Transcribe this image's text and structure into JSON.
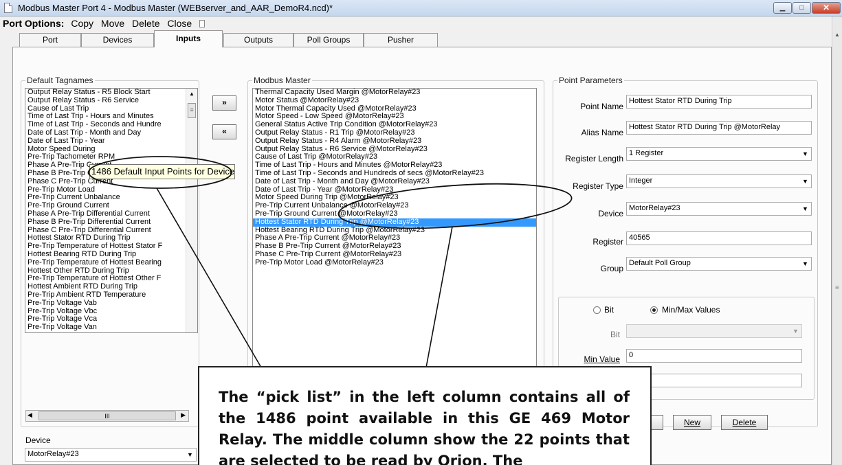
{
  "window": {
    "title": "Modbus Master Port 4 - Modbus Master (WEBserver_and_AAR_DemoR4.ncd)*"
  },
  "port_options": {
    "label": "Port Options:",
    "items": [
      "Copy",
      "Move",
      "Delete",
      "Close"
    ]
  },
  "tabs": [
    {
      "label": "Port"
    },
    {
      "label": "Devices"
    },
    {
      "label": "Inputs"
    },
    {
      "label": "Outputs"
    },
    {
      "label": "Poll Groups"
    },
    {
      "label": "Pusher"
    }
  ],
  "default_tagnames": {
    "legend": "Default Tagnames",
    "items": [
      "Output Relay Status - R5 Block Start",
      "Output Relay Status - R6 Service",
      "Cause of Last Trip",
      "Time of Last Trip - Hours and Minutes",
      "Time of Last Trip - Seconds and Hundre",
      "Date of Last Trip - Month and Day",
      "Date of Last Trip - Year",
      "Motor Speed During",
      "Pre-Trip Tachometer RPM",
      "Phase A Pre-Trip Current",
      "Phase B Pre-Trip Current",
      "Phase C Pre-Trip Current",
      "Pre-Trip Motor Load",
      "Pre-Trip Current Unbalance",
      "Pre-Trip Ground Current",
      "Phase A Pre-Trip Differential Current",
      "Phase B Pre-Trip Differential Current",
      "Phase C Pre-Trip Differential Current",
      "Hottest Stator RTD During Trip",
      "Pre-Trip Temperature of Hottest Stator F",
      "Hottest Bearing RTD During Trip",
      "Pre-Trip Temperature of Hottest Bearing",
      "Hottest Other RTD During Trip",
      "Pre-Trip Temperature of Hottest Other F",
      "Hottest Ambient RTD During Trip",
      "Pre-Trip Ambient RTD Temperature",
      "Pre-Trip Voltage Vab",
      "Pre-Trip Voltage Vbc",
      "Pre-Trip Voltage Vca",
      "Pre-Trip Voltage Van"
    ],
    "hscroll_grip": "III"
  },
  "tooltip": "1486 Default Input Points for Device",
  "move_buttons": {
    "add": "»",
    "remove": "«"
  },
  "device": {
    "label": "Device",
    "value": "MotorRelay#23"
  },
  "modbus_master": {
    "legend": "Modbus Master",
    "items": [
      "Thermal Capacity Used Margin @MotorRelay#23",
      "Motor Status @MotorRelay#23",
      "Motor Thermal Capacity Used @MotorRelay#23",
      "Motor Speed - Low Speed @MotorRelay#23",
      "General Status Active Trip Condition @MotorRelay#23",
      "Output Relay Status - R1 Trip @MotorRelay#23",
      "Output Relay Status - R4 Alarm @MotorRelay#23",
      "Output Relay Status - R6 Service @MotorRelay#23",
      "Cause of Last Trip @MotorRelay#23",
      "Time of Last Trip - Hours and Minutes @MotorRelay#23",
      "Time of Last Trip - Seconds and Hundreds of secs @MotorRelay#23",
      "Date of Last Trip - Month and Day @MotorRelay#23",
      "Date of Last Trip - Year @MotorRelay#23",
      "Motor Speed During Trip @MotorRelay#23",
      "Pre-Trip Current Unbalance @MotorRelay#23",
      "Pre-Trip Ground Current @MotorRelay#23",
      "Hottest Stator RTD During Trip @MotorRelay#23",
      "Hottest Bearing RTD During Trip @MotorRelay#23",
      "Phase A Pre-Trip Current @MotorRelay#23",
      "Phase B Pre-Trip Current @MotorRelay#23",
      "Phase C Pre-Trip Current @MotorRelay#23",
      "Pre-Trip Motor Load @MotorRelay#23"
    ],
    "selected_item": "Hottest Stator RTD During Trip @MotorRelay#23"
  },
  "point_parameters": {
    "legend": "Point Parameters",
    "point_name": {
      "label": "Point Name",
      "value": "Hottest Stator RTD During Trip"
    },
    "alias_name": {
      "label": "Alias Name",
      "value": "Hottest Stator RTD During Trip @MotorRelay"
    },
    "register_length": {
      "label": "Register Length",
      "value": "1 Register"
    },
    "register_type": {
      "label": "Register Type",
      "value": "Integer"
    },
    "device": {
      "label": "Device",
      "value": "MotorRelay#23"
    },
    "register": {
      "label": "Register",
      "value": "40565"
    },
    "group": {
      "label": "Group",
      "value": "Default Poll Group"
    },
    "bit_radio": "Bit",
    "minmax_radio": "Min/Max Values",
    "bit_label": "Bit",
    "min_value": {
      "label": "Min Value",
      "value": "0"
    },
    "buttons": {
      "cancel": "Cancel",
      "new": "New",
      "delete": "Delete"
    }
  },
  "callout": "The “pick list” in the left column contains all of the 1486 point available in this GE 469 Motor Relay. The middle column show the 22 points that are selected to be read by Orion. The"
}
